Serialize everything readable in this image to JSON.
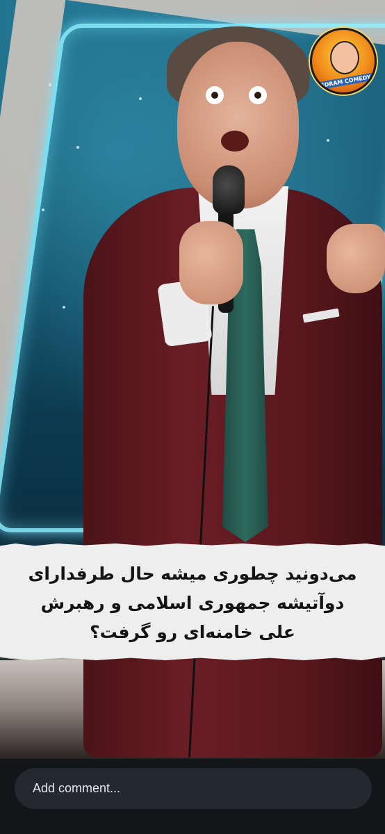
{
  "post": {
    "caption": "می‌دونید چطوری میشه حال طرفدارای دوآتیشه جمهوری اسلامی و رهبرش علی خامنه‌ای رو گرفت؟",
    "channel_logo_text": "PEDRAM COMEDY"
  },
  "comment_bar": {
    "placeholder": "Add comment..."
  },
  "colors": {
    "caption_background": "#eeeeee",
    "bottom_bar_background": "#121619",
    "input_background": "#23292e"
  }
}
